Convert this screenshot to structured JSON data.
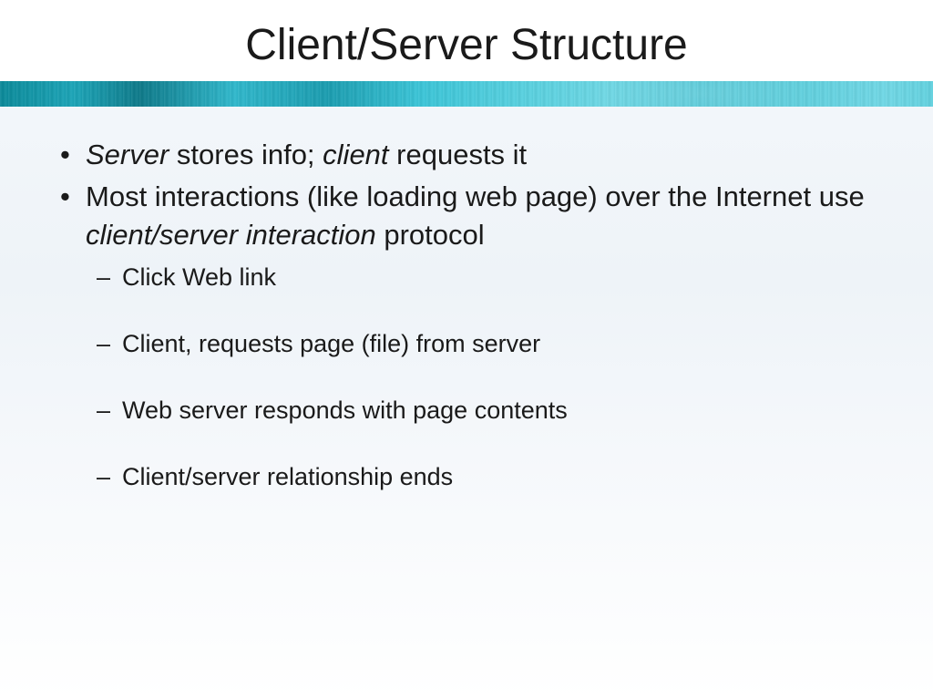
{
  "slide": {
    "title": "Client/Server Structure",
    "bullets": [
      {
        "segments": [
          {
            "text": "Server",
            "italic": true
          },
          {
            "text": " stores info; ",
            "italic": false
          },
          {
            "text": "client",
            "italic": true
          },
          {
            "text": " requests it",
            "italic": false
          }
        ]
      },
      {
        "segments": [
          {
            "text": "Most interactions (like loading web page) over the Internet use ",
            "italic": false
          },
          {
            "text": "client/server interaction",
            "italic": true
          },
          {
            "text": " protocol",
            "italic": false
          }
        ],
        "sub": [
          "Click Web link",
          "Client, requests page (file) from server",
          "Web server responds with page contents",
          "Client/server relationship ends"
        ]
      }
    ]
  }
}
